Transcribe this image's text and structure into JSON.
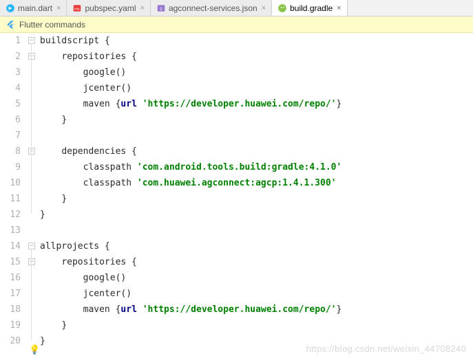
{
  "tabs": [
    {
      "label": "main.dart",
      "icon": "dart",
      "active": false
    },
    {
      "label": "pubspec.yaml",
      "icon": "yaml",
      "active": false
    },
    {
      "label": "agconnect-services.json",
      "icon": "json",
      "active": false
    },
    {
      "label": "build.gradle",
      "icon": "gradle",
      "active": true
    }
  ],
  "banner": {
    "label": "Flutter commands"
  },
  "code": {
    "lines": [
      [
        {
          "t": "buildscript {",
          "c": "plain",
          "indent": 0
        }
      ],
      [
        {
          "t": "repositories {",
          "c": "plain",
          "indent": 1
        }
      ],
      [
        {
          "t": "google()",
          "c": "plain",
          "indent": 2
        }
      ],
      [
        {
          "t": "jcenter()",
          "c": "plain",
          "indent": 2
        }
      ],
      [
        {
          "t": "maven {",
          "c": "plain",
          "indent": 2
        },
        {
          "t": "url ",
          "c": "kw"
        },
        {
          "t": "'https://developer.huawei.com/repo/'",
          "c": "str"
        },
        {
          "t": "}",
          "c": "plain"
        }
      ],
      [
        {
          "t": "}",
          "c": "plain",
          "indent": 1
        }
      ],
      [],
      [
        {
          "t": "dependencies {",
          "c": "plain",
          "indent": 1
        }
      ],
      [
        {
          "t": "classpath ",
          "c": "plain",
          "indent": 2
        },
        {
          "t": "'com.android.tools.build:gradle:4.1.0'",
          "c": "str"
        }
      ],
      [
        {
          "t": "classpath ",
          "c": "plain",
          "indent": 2
        },
        {
          "t": "'com.huawei.agconnect:agcp:1.4.1.300'",
          "c": "str"
        }
      ],
      [
        {
          "t": "}",
          "c": "plain",
          "indent": 1
        }
      ],
      [
        {
          "t": "}",
          "c": "plain",
          "indent": 0
        }
      ],
      [],
      [
        {
          "t": "allprojects {",
          "c": "plain",
          "indent": 0
        }
      ],
      [
        {
          "t": "repositories {",
          "c": "plain",
          "indent": 1
        }
      ],
      [
        {
          "t": "google()",
          "c": "plain",
          "indent": 2
        }
      ],
      [
        {
          "t": "jcenter()",
          "c": "plain",
          "indent": 2
        }
      ],
      [
        {
          "t": "maven {",
          "c": "plain",
          "indent": 2
        },
        {
          "t": "url ",
          "c": "kw"
        },
        {
          "t": "'https://developer.huawei.com/repo/'",
          "c": "str"
        },
        {
          "t": "}",
          "c": "plain"
        }
      ],
      [
        {
          "t": "}",
          "c": "plain",
          "indent": 1
        }
      ],
      [
        {
          "t": "}",
          "c": "plain",
          "indent": 0
        }
      ]
    ]
  },
  "watermark": "https://blog.csdn.net/weixin_44708240"
}
